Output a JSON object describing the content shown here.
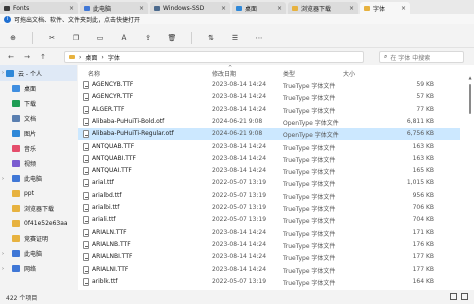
{
  "tabs": [
    {
      "label": "Fonts",
      "color": "#3b3b3b",
      "count": ""
    },
    {
      "label": "此电脑",
      "color": "#3f77d6",
      "count": ""
    },
    {
      "label": "Windows-SSD",
      "color": "#4c6a8d",
      "count": ""
    },
    {
      "label": "桌面",
      "color": "#2f88d8",
      "count": ""
    },
    {
      "label": "浏览器下载",
      "color": "#e7b23f",
      "count": ""
    },
    {
      "label": "字体",
      "color": "#e7b23f",
      "count": ""
    }
  ],
  "notice": {
    "icon": "info-icon",
    "text": "可拖出文档、软件、文件夹到此，点击快捷打开"
  },
  "breadcrumb": [
    "桌面",
    "字体"
  ],
  "search_placeholder": "在 字体 中搜索",
  "columns": {
    "name": "名称",
    "date": "修改日期",
    "type": "类型",
    "size": "大小"
  },
  "files": [
    {
      "name": "AGENCYB.TTF",
      "date": "2023-08-14 14:24",
      "type": "TrueType 字体文件",
      "size": "59 KB"
    },
    {
      "name": "AGENCYR.TTF",
      "date": "2023-08-14 14:24",
      "type": "TrueType 字体文件",
      "size": "57 KB"
    },
    {
      "name": "ALGER.TTF",
      "date": "2023-08-14 14:24",
      "type": "TrueType 字体文件",
      "size": "77 KB"
    },
    {
      "name": "Alibaba-PuHuiTi-Bold.otf",
      "date": "2024-06-21 9:08",
      "type": "OpenType 字体文件",
      "size": "6,811 KB"
    },
    {
      "name": "Alibaba-PuHuiTi-Regular.otf",
      "date": "2024-06-21 9:08",
      "type": "OpenType 字体文件",
      "size": "6,756 KB"
    },
    {
      "name": "ANTQUAB.TTF",
      "date": "2023-08-14 14:24",
      "type": "TrueType 字体文件",
      "size": "163 KB"
    },
    {
      "name": "ANTQUABI.TTF",
      "date": "2023-08-14 14:24",
      "type": "TrueType 字体文件",
      "size": "163 KB"
    },
    {
      "name": "ANTQUAI.TTF",
      "date": "2023-08-14 14:24",
      "type": "TrueType 字体文件",
      "size": "165 KB"
    },
    {
      "name": "arial.ttf",
      "date": "2022-05-07 13:19",
      "type": "TrueType 字体文件",
      "size": "1,015 KB"
    },
    {
      "name": "arialbd.ttf",
      "date": "2022-05-07 13:19",
      "type": "TrueType 字体文件",
      "size": "956 KB"
    },
    {
      "name": "arialbi.ttf",
      "date": "2022-05-07 13:19",
      "type": "TrueType 字体文件",
      "size": "706 KB"
    },
    {
      "name": "ariali.ttf",
      "date": "2022-05-07 13:19",
      "type": "TrueType 字体文件",
      "size": "704 KB"
    },
    {
      "name": "ARIALN.TTF",
      "date": "2023-08-14 14:24",
      "type": "TrueType 字体文件",
      "size": "171 KB"
    },
    {
      "name": "ARIALNB.TTF",
      "date": "2023-08-14 14:24",
      "type": "TrueType 字体文件",
      "size": "176 KB"
    },
    {
      "name": "ARIALNBI.TTF",
      "date": "2023-08-14 14:24",
      "type": "TrueType 字体文件",
      "size": "177 KB"
    },
    {
      "name": "ARIALNI.TTF",
      "date": "2023-08-14 14:24",
      "type": "TrueType 字体文件",
      "size": "177 KB"
    },
    {
      "name": "ariblk.ttf",
      "date": "2022-05-07 13:19",
      "type": "TrueType 字体文件",
      "size": "164 KB"
    }
  ],
  "selected_index": 4,
  "sidebar": [
    {
      "label": "云 - 个人",
      "icon": "cloud-icon",
      "color": "#2f88d8"
    },
    {
      "label": "桌面",
      "icon": "desktop-icon",
      "color": "#3f8ee0"
    },
    {
      "label": "下载",
      "icon": "download-icon",
      "color": "#1f9d55"
    },
    {
      "label": "文档",
      "icon": "document-icon",
      "color": "#5a7fb0"
    },
    {
      "label": "图片",
      "icon": "picture-icon",
      "color": "#2f88d8"
    },
    {
      "label": "音乐",
      "icon": "music-icon",
      "color": "#e44d6b"
    },
    {
      "label": "视频",
      "icon": "video-icon",
      "color": "#7a5cd0"
    },
    {
      "label": "此电脑",
      "icon": "computer-icon",
      "color": "#3f77d6"
    },
    {
      "label": "ppt",
      "icon": "folder-icon",
      "color": "#e7b23f"
    },
    {
      "label": "浏览器下载",
      "icon": "folder-icon",
      "color": "#e7b23f"
    },
    {
      "label": "0f41e52e63aa",
      "icon": "folder-icon",
      "color": "#e7b23f"
    },
    {
      "label": "竞赛证明",
      "icon": "folder-icon",
      "color": "#e7b23f"
    },
    {
      "label": "此电脑",
      "icon": "computer-icon",
      "color": "#3f77d6"
    },
    {
      "label": "网络",
      "icon": "network-icon",
      "color": "#3f77d6"
    }
  ],
  "status": "422 个项目"
}
